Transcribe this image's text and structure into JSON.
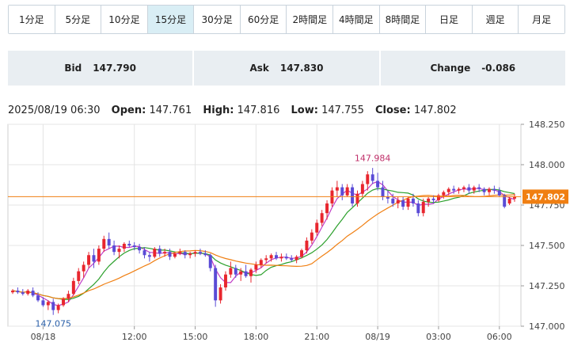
{
  "tabs": [
    "1分足",
    "5分足",
    "10分足",
    "15分足",
    "30分足",
    "60分足",
    "2時間足",
    "4時間足",
    "8時間足",
    "日足",
    "週足",
    "月足"
  ],
  "active_tab": "15分足",
  "quote": {
    "bid_label": "Bid",
    "bid": "147.790",
    "ask_label": "Ask",
    "ask": "147.830",
    "change_label": "Change",
    "change": "-0.086"
  },
  "ohlc": {
    "datetime": "2025/08/19 06:30",
    "open_label": "Open:",
    "open": "147.761",
    "high_label": "High:",
    "high": "147.816",
    "low_label": "Low:",
    "low": "147.755",
    "close_label": "Close:",
    "close": "147.802"
  },
  "colors": {
    "up": "#e8262e",
    "down": "#5a4bd6",
    "ma_short": "#c03cc6",
    "ma_mid": "#2ca02c",
    "ma_long": "#f07f12",
    "price_line": "#f07f12",
    "grid": "#e4e4e4"
  },
  "chart_data": {
    "type": "candlestick",
    "ylim": [
      147.0,
      148.25
    ],
    "yticks": [
      "148.250",
      "148.000",
      "147.750",
      "147.500",
      "147.250",
      "147.000"
    ],
    "xticks": [
      {
        "label": "08/18",
        "i": 6
      },
      {
        "label": "12:00",
        "i": 24
      },
      {
        "label": "15:00",
        "i": 36
      },
      {
        "label": "18:00",
        "i": 48
      },
      {
        "label": "21:00",
        "i": 60
      },
      {
        "label": "08/19",
        "i": 72
      },
      {
        "label": "03:00",
        "i": 84
      },
      {
        "label": "06:00",
        "i": 96
      }
    ],
    "current_price": "147.802",
    "current_value": 147.802,
    "annotations": [
      {
        "text": "147.984",
        "value": 147.984,
        "i": 71,
        "pos": "above"
      },
      {
        "text": "147.075",
        "value": 147.075,
        "i": 8,
        "pos": "below"
      }
    ],
    "series_names": [
      "MA short",
      "MA mid",
      "MA long"
    ],
    "candles": [
      [
        147.21,
        147.23,
        147.2,
        147.22
      ],
      [
        147.22,
        147.24,
        147.2,
        147.21
      ],
      [
        147.21,
        147.23,
        147.19,
        147.2
      ],
      [
        147.2,
        147.23,
        147.19,
        147.22
      ],
      [
        147.22,
        147.24,
        147.18,
        147.19
      ],
      [
        147.19,
        147.21,
        147.15,
        147.16
      ],
      [
        147.16,
        147.18,
        147.12,
        147.13
      ],
      [
        147.13,
        147.16,
        147.1,
        147.15
      ],
      [
        147.15,
        147.17,
        147.07,
        147.1
      ],
      [
        147.1,
        147.14,
        147.08,
        147.13
      ],
      [
        147.13,
        147.18,
        147.12,
        147.17
      ],
      [
        147.17,
        147.22,
        147.15,
        147.2
      ],
      [
        147.2,
        147.3,
        147.19,
        147.28
      ],
      [
        147.28,
        147.36,
        147.26,
        147.34
      ],
      [
        147.34,
        147.4,
        147.3,
        147.38
      ],
      [
        147.38,
        147.46,
        147.36,
        147.44
      ],
      [
        147.44,
        147.48,
        147.36,
        147.4
      ],
      [
        147.4,
        147.5,
        147.38,
        147.48
      ],
      [
        147.48,
        147.56,
        147.46,
        147.54
      ],
      [
        147.54,
        147.58,
        147.48,
        147.5
      ],
      [
        147.5,
        147.53,
        147.44,
        147.46
      ],
      [
        147.46,
        147.5,
        147.42,
        147.48
      ],
      [
        147.48,
        147.52,
        147.46,
        147.51
      ],
      [
        147.51,
        147.53,
        147.49,
        147.5
      ],
      [
        147.5,
        147.52,
        147.47,
        147.49
      ],
      [
        147.49,
        147.51,
        147.45,
        147.47
      ],
      [
        147.47,
        147.49,
        147.42,
        147.44
      ],
      [
        147.44,
        147.46,
        147.4,
        147.43
      ],
      [
        147.43,
        147.49,
        147.42,
        147.48
      ],
      [
        147.48,
        147.5,
        147.43,
        147.45
      ],
      [
        147.45,
        147.48,
        147.43,
        147.46
      ],
      [
        147.46,
        147.48,
        147.41,
        147.43
      ],
      [
        147.43,
        147.46,
        147.42,
        147.45
      ],
      [
        147.45,
        147.48,
        147.44,
        147.46
      ],
      [
        147.46,
        147.47,
        147.42,
        147.44
      ],
      [
        147.44,
        147.46,
        147.42,
        147.45
      ],
      [
        147.45,
        147.47,
        147.43,
        147.46
      ],
      [
        147.46,
        147.48,
        147.44,
        147.45
      ],
      [
        147.45,
        147.47,
        147.43,
        147.44
      ],
      [
        147.44,
        147.45,
        147.34,
        147.36
      ],
      [
        147.36,
        147.38,
        147.12,
        147.16
      ],
      [
        147.16,
        147.26,
        147.14,
        147.24
      ],
      [
        147.24,
        147.34,
        147.22,
        147.32
      ],
      [
        147.32,
        147.4,
        147.3,
        147.36
      ],
      [
        147.36,
        147.38,
        147.3,
        147.32
      ],
      [
        147.32,
        147.36,
        147.28,
        147.34
      ],
      [
        147.34,
        147.38,
        147.3,
        147.31
      ],
      [
        147.31,
        147.36,
        147.27,
        147.35
      ],
      [
        147.35,
        147.4,
        147.33,
        147.38
      ],
      [
        147.38,
        147.42,
        147.36,
        147.41
      ],
      [
        147.41,
        147.44,
        147.39,
        147.42
      ],
      [
        147.42,
        147.45,
        147.4,
        147.44
      ],
      [
        147.44,
        147.46,
        147.41,
        147.42
      ],
      [
        147.42,
        147.45,
        147.4,
        147.43
      ],
      [
        147.43,
        147.45,
        147.41,
        147.42
      ],
      [
        147.42,
        147.44,
        147.4,
        147.41
      ],
      [
        147.41,
        147.44,
        147.39,
        147.43
      ],
      [
        147.43,
        147.48,
        147.42,
        147.47
      ],
      [
        147.47,
        147.55,
        147.45,
        147.53
      ],
      [
        147.53,
        147.6,
        147.51,
        147.58
      ],
      [
        147.58,
        147.66,
        147.56,
        147.64
      ],
      [
        147.64,
        147.72,
        147.62,
        147.7
      ],
      [
        147.7,
        147.78,
        147.66,
        147.76
      ],
      [
        147.76,
        147.86,
        147.74,
        147.84
      ],
      [
        147.84,
        147.9,
        147.8,
        147.86
      ],
      [
        147.86,
        147.88,
        147.78,
        147.81
      ],
      [
        147.81,
        147.88,
        147.8,
        147.86
      ],
      [
        147.86,
        147.88,
        147.74,
        147.76
      ],
      [
        147.76,
        147.84,
        147.74,
        147.82
      ],
      [
        147.82,
        147.9,
        147.8,
        147.88
      ],
      [
        147.88,
        147.96,
        147.84,
        147.94
      ],
      [
        147.94,
        147.98,
        147.88,
        147.9
      ],
      [
        147.9,
        147.95,
        147.84,
        147.86
      ],
      [
        147.86,
        147.9,
        147.78,
        147.8
      ],
      [
        147.8,
        147.84,
        147.76,
        147.79
      ],
      [
        147.79,
        147.82,
        147.74,
        147.76
      ],
      [
        147.76,
        147.8,
        147.73,
        147.78
      ],
      [
        147.78,
        147.8,
        147.72,
        147.74
      ],
      [
        147.74,
        147.8,
        147.72,
        147.79
      ],
      [
        147.79,
        147.82,
        147.74,
        147.76
      ],
      [
        147.76,
        147.78,
        147.68,
        147.7
      ],
      [
        147.7,
        147.79,
        147.68,
        147.77
      ],
      [
        147.77,
        147.8,
        147.74,
        147.79
      ],
      [
        147.79,
        147.81,
        147.76,
        147.78
      ],
      [
        147.78,
        147.82,
        147.77,
        147.81
      ],
      [
        147.81,
        147.84,
        147.79,
        147.83
      ],
      [
        147.83,
        147.86,
        147.81,
        147.85
      ],
      [
        147.85,
        147.87,
        147.82,
        147.84
      ],
      [
        147.84,
        147.86,
        147.82,
        147.85
      ],
      [
        147.85,
        147.87,
        147.83,
        147.86
      ],
      [
        147.86,
        147.88,
        147.82,
        147.84
      ],
      [
        147.84,
        147.87,
        147.82,
        147.86
      ],
      [
        147.86,
        147.88,
        147.83,
        147.85
      ],
      [
        147.85,
        147.86,
        147.81,
        147.83
      ],
      [
        147.83,
        147.86,
        147.81,
        147.85
      ],
      [
        147.85,
        147.87,
        147.82,
        147.84
      ],
      [
        147.84,
        147.86,
        147.8,
        147.81
      ],
      [
        147.81,
        147.82,
        147.73,
        147.74
      ],
      [
        147.76,
        147.8,
        147.75,
        147.79
      ],
      [
        147.79,
        147.82,
        147.77,
        147.8
      ]
    ]
  }
}
